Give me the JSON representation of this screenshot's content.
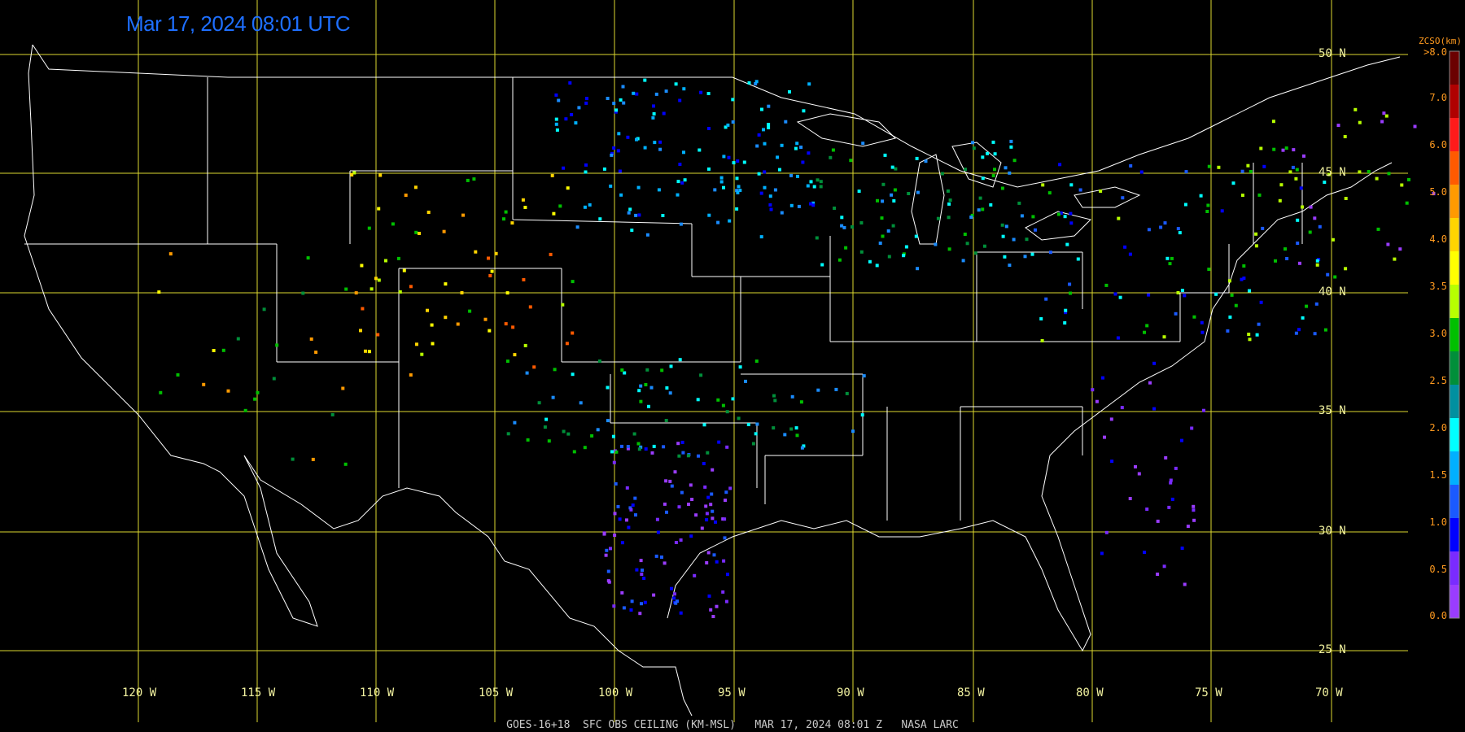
{
  "timestamp": "Mar 17, 2024 08:01 UTC",
  "footer": "GOES-16+18  SFC OBS CEILING (KM-MSL)   MAR 17, 2024 08:01 Z   NASA LARC",
  "lat_lines": [
    "50 N",
    "45 N",
    "40 N",
    "35 N",
    "30 N",
    "25 N"
  ],
  "lon_lines": [
    "120 W",
    "115 W",
    "110 W",
    "105 W",
    "100 W",
    "95 W",
    "90 W",
    "85 W",
    "80 W",
    "75 W",
    "70 W"
  ],
  "colorbar": {
    "title": "ZCSO(km)",
    "top_label": ">8.0",
    "labels": [
      "7.0",
      "6.0",
      "5.0",
      "4.0",
      "3.5",
      "3.0",
      "2.5",
      "2.0",
      "1.5",
      "1.0",
      "0.5",
      "0.0"
    ],
    "colors": [
      "#6b0000",
      "#b00000",
      "#ff1a1a",
      "#ff5a00",
      "#ff9a00",
      "#ffd400",
      "#ffff00",
      "#b7ff00",
      "#00c000",
      "#008f3a",
      "#0090a0",
      "#00ffff",
      "#00b0ff",
      "#1a5aff",
      "#0000ff",
      "#7a2bff",
      "#9a3cff"
    ]
  },
  "grid_color": "#dcd830",
  "border_color": "#ffffff",
  "background": "#000000"
}
